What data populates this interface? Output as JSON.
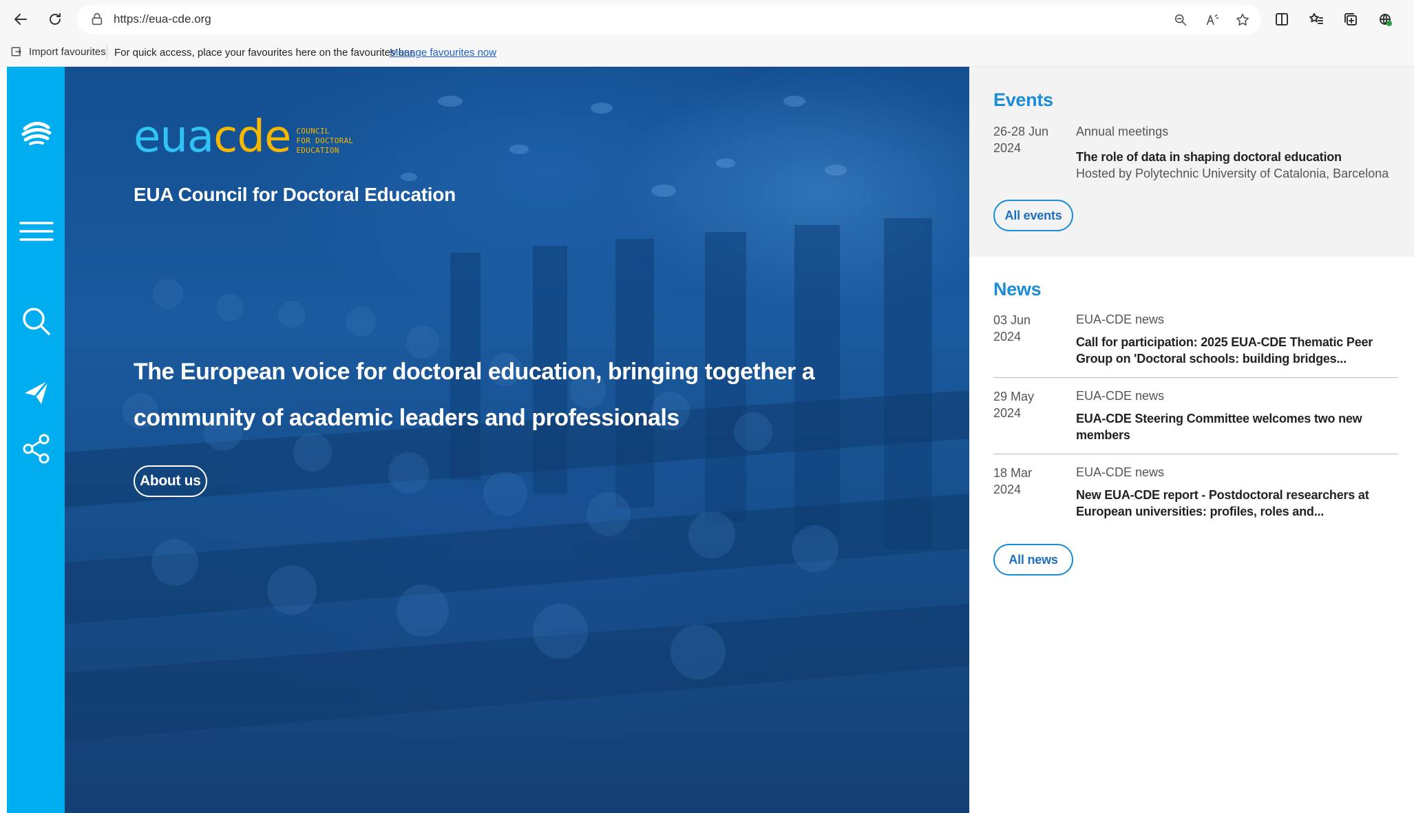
{
  "browser": {
    "url": "https://eua-cde.org",
    "favourites_bar": {
      "import_label": "Import favourites",
      "message": "For quick access, place your favourites here on the favourites bar.",
      "manage_link": "Manage favourites now"
    },
    "icons": [
      "back-icon",
      "refresh-icon",
      "lock-icon",
      "zoom-icon",
      "read-aloud-icon",
      "favorite-star-icon",
      "split-screen-icon",
      "favorites-icon",
      "collections-icon",
      "extensions-icon"
    ]
  },
  "colors": {
    "accent_cyan": "#00aeef",
    "logo_blue": "#2fc2f3",
    "logo_yellow": "#f5b800",
    "heading_blue": "#1a8cd8",
    "hero_blue": "#1a5a9e"
  },
  "sidebar": {
    "icons": [
      "globe-logo-icon",
      "menu-icon",
      "search-icon",
      "send-icon",
      "share-icon"
    ]
  },
  "hero": {
    "logo_eua": "eua",
    "logo_cde": "cde",
    "logo_sub": [
      "COUNCIL",
      "FOR DOCTORAL",
      "EDUCATION"
    ],
    "site_name": "EUA Council for Doctoral Education",
    "tagline": "The European voice for doctoral education, bringing together a community of academic leaders and professionals",
    "cta_label": "About us"
  },
  "events": {
    "title": "Events",
    "items": [
      {
        "date_line1": "26-28 Jun",
        "date_line2": "2024",
        "category": "Annual meetings",
        "title": "The role of data in shaping doctoral education",
        "subtitle": "Hosted by Polytechnic University of Catalonia, Barcelona"
      }
    ],
    "button_label": "All events"
  },
  "news": {
    "title": "News",
    "items": [
      {
        "date_line1": "03 Jun",
        "date_line2": "2024",
        "category": "EUA-CDE news",
        "title": "Call for participation: 2025 EUA-CDE Thematic Peer Group on 'Doctoral schools: building bridges..."
      },
      {
        "date_line1": "29 May",
        "date_line2": "2024",
        "category": "EUA-CDE news",
        "title": "EUA-CDE Steering Committee welcomes two new members"
      },
      {
        "date_line1": "18 Mar",
        "date_line2": "2024",
        "category": "EUA-CDE news",
        "title": "New EUA-CDE report - Postdoctoral researchers at European universities: profiles, roles and..."
      }
    ],
    "button_label": "All news"
  }
}
